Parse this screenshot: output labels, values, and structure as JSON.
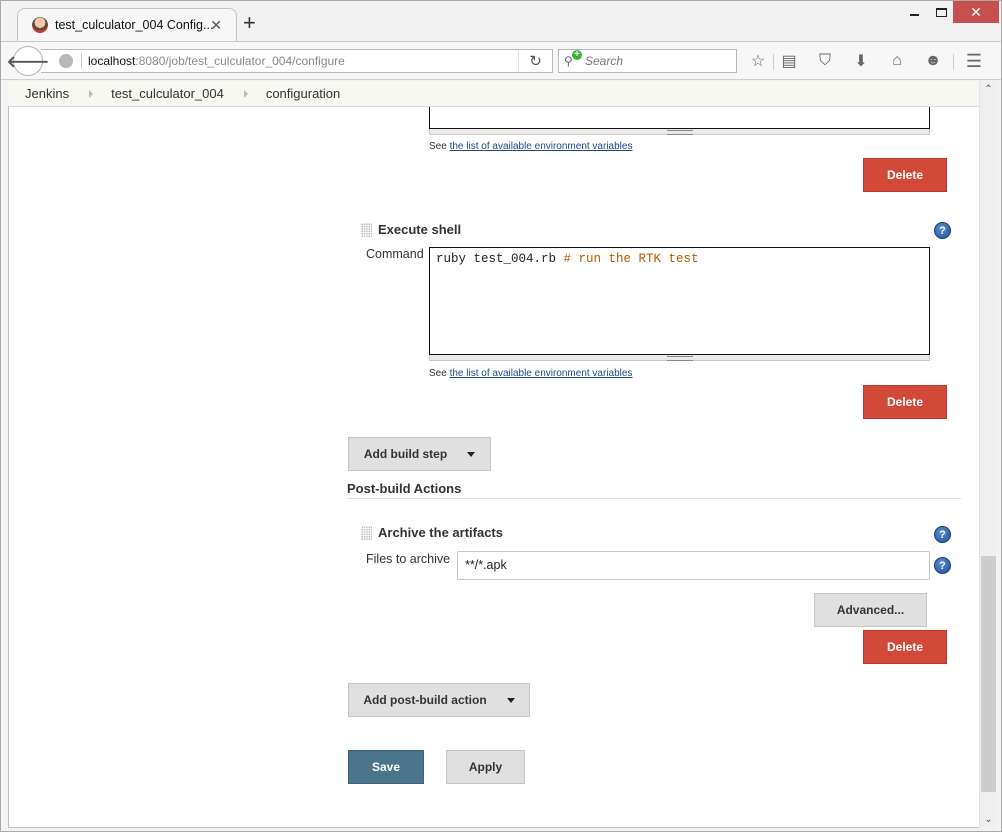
{
  "browser": {
    "tab": {
      "title": "test_culculator_004 Config...",
      "close_icon": "close-icon",
      "favicon": "jenkins-butler-icon"
    },
    "new_tab_label": "+",
    "window_controls": {
      "minimize": "minimize-icon",
      "maximize": "maximize-icon",
      "close": "✕"
    },
    "back_icon": "🡐",
    "url": {
      "host": "localhost",
      "rest": ":8080/job/test_culculator_004/configure"
    },
    "reload_icon": "↻",
    "search": {
      "placeholder": "Search"
    },
    "toolbar_icons": [
      {
        "name": "bookmark-star-icon",
        "glyph": "☆"
      },
      {
        "name": "reading-list-icon",
        "glyph": "▤"
      },
      {
        "name": "pocket-icon",
        "glyph": "⛉"
      },
      {
        "name": "download-icon",
        "glyph": "⬇"
      },
      {
        "name": "home-icon",
        "glyph": "⌂"
      },
      {
        "name": "chat-icon",
        "glyph": "☻"
      },
      {
        "name": "menu-icon",
        "glyph": "☰"
      }
    ]
  },
  "breadcrumb": [
    "Jenkins",
    "test_culculator_004",
    "configuration"
  ],
  "env_vars_link": {
    "prefix": "See ",
    "link": "the list of available environment variables"
  },
  "build_steps": [
    {
      "delete_label": "Delete"
    },
    {
      "title": "Execute shell",
      "command_label": "Command",
      "command_code": "ruby test_004.rb ",
      "command_comment": "# run the RTK test",
      "delete_label": "Delete"
    }
  ],
  "add_build_step_label": "Add build step",
  "post_build": {
    "heading": "Post-build Actions",
    "actions": [
      {
        "title": "Archive the artifacts",
        "files_label": "Files to archive",
        "files_value": "**/*.apk",
        "advanced_label": "Advanced...",
        "delete_label": "Delete"
      }
    ],
    "add_label": "Add post-build action"
  },
  "footer": {
    "save_label": "Save",
    "apply_label": "Apply"
  },
  "help_glyph": "?",
  "scrollbar": {
    "position_fraction": 0.67,
    "up_glyph": "⌃",
    "down_glyph": "⌄"
  },
  "colors": {
    "delete": "#d24939",
    "save": "#4b758b",
    "comment": "#b05a00",
    "breadcrumb_bg": "#f6f8f1",
    "window_close": "#c7504f"
  }
}
